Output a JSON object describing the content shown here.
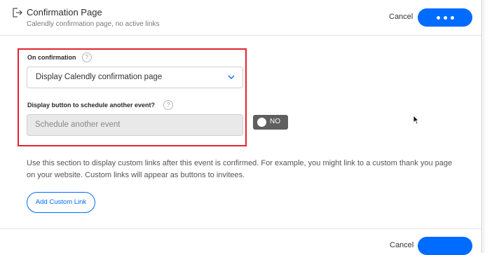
{
  "header": {
    "icon": "exit-arrow-icon",
    "title": "Confirmation Page",
    "subtitle": "Calendly confirmation page, no active links",
    "cancel_label": "Cancel",
    "more_icon": "more-dots-icon"
  },
  "form": {
    "on_confirmation_label": "On confirmation",
    "help_icon": "question-mark-icon",
    "help_glyph": "?",
    "select_value": "Display Calendly confirmation page",
    "schedule_label": "Display button to schedule another event?",
    "schedule_value": "Schedule another event",
    "toggle_label": "NO"
  },
  "description": {
    "line1": "Use this section to display custom links after this event is confirmed. For example, you might link to a custom thank you page",
    "line2": "on your website. Custom links will appear as buttons to invitees."
  },
  "add_link_label": "Add Custom Link",
  "footer": {
    "cancel_label": "Cancel"
  },
  "colors": {
    "accent": "#006bff",
    "highlight_box": "#e3232f",
    "toggle_off": "#5f5f5f"
  }
}
